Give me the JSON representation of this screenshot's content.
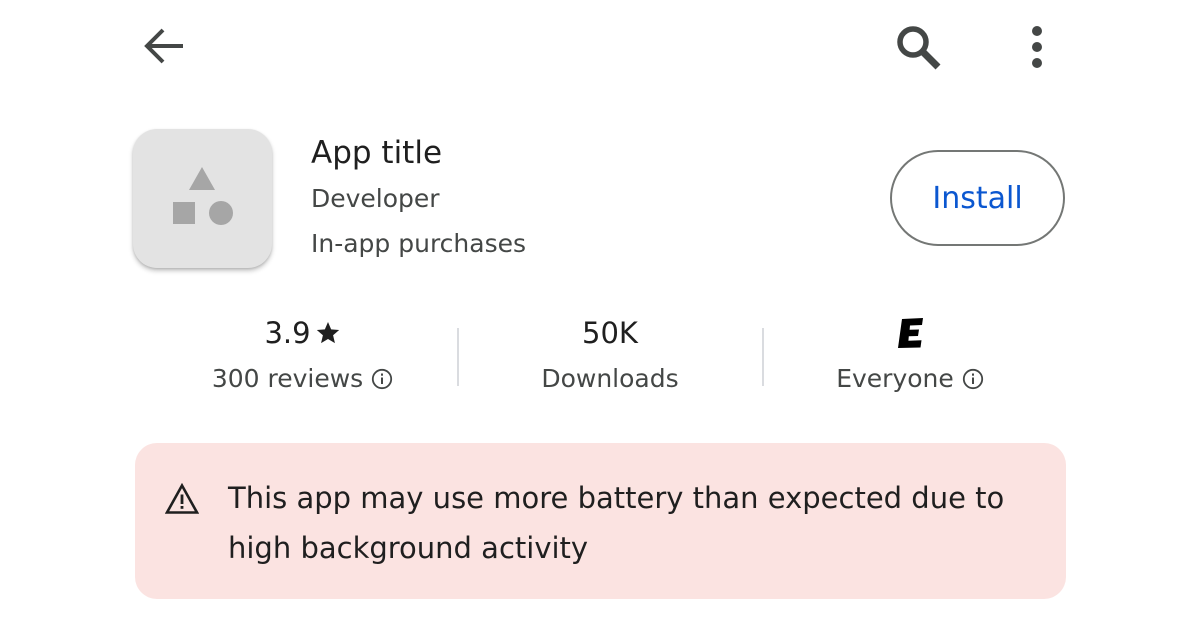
{
  "topbar": {
    "back_icon": "arrow-back-icon",
    "search_icon": "search-icon",
    "more_icon": "more-vert-icon"
  },
  "app": {
    "icon": "app-placeholder-shapes-icon",
    "title": "App title",
    "developer": "Developer",
    "purchases": "In-app purchases"
  },
  "install_button": {
    "label": "Install",
    "color": "#0b57d0"
  },
  "stats": {
    "rating": {
      "value": "3.9",
      "star_icon": "star-icon",
      "label": "300 reviews",
      "info_icon": "info-icon"
    },
    "downloads": {
      "value": "50K",
      "label": "Downloads"
    },
    "content_rating": {
      "badge_icon": "esrb-e-icon",
      "label": "Everyone",
      "info_icon": "info-icon"
    }
  },
  "warning": {
    "icon": "warning-icon",
    "text": "This app may use more battery than expected due to high background activity",
    "background": "#fbe3e1"
  }
}
